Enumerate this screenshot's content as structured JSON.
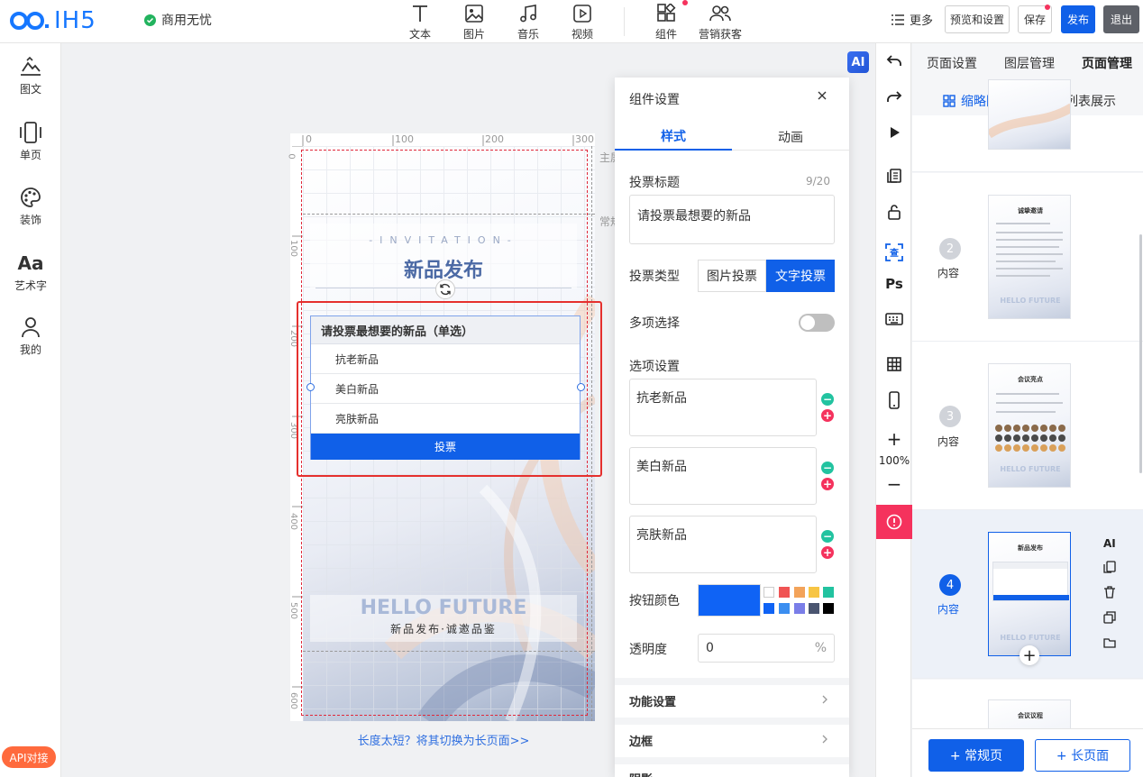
{
  "header": {
    "logo_text": "IH5",
    "status_badge": "商用无忧",
    "tools": [
      {
        "label": "文本",
        "icon": "text-icon"
      },
      {
        "label": "图片",
        "icon": "image-icon"
      },
      {
        "label": "音乐",
        "icon": "music-icon"
      },
      {
        "label": "视频",
        "icon": "video-icon"
      },
      {
        "label": "组件",
        "icon": "components-icon"
      },
      {
        "label": "营销获客",
        "icon": "users-icon"
      }
    ],
    "more_label": "更多",
    "preview_label": "预览和设置",
    "save_label": "保存",
    "publish_label": "发布",
    "exit_label": "退出"
  },
  "left_sidebar": {
    "items": [
      {
        "label": "图文",
        "icon": "image-text-icon"
      },
      {
        "label": "单页",
        "icon": "single-page-icon"
      },
      {
        "label": "装饰",
        "icon": "palette-icon"
      },
      {
        "label": "艺术字",
        "icon": "art-text-icon"
      },
      {
        "label": "我的",
        "icon": "user-icon"
      }
    ],
    "api_button": "API对接"
  },
  "canvas": {
    "ruler_top": [
      "0",
      "100",
      "200",
      "300"
    ],
    "ruler_left": [
      "0",
      "100",
      "200",
      "300",
      "400",
      "500",
      "600"
    ],
    "side_labels": [
      "主屏",
      "常规"
    ],
    "invitation_sub": "-INVITATION-",
    "invitation_title": "新品发布",
    "vote_component": {
      "question": "请投票最想要的新品（单选）",
      "options": [
        "抗老新品",
        "美白新品",
        "亮肤新品"
      ],
      "button": "投票"
    },
    "hello_title": "HELLO FUTURE",
    "hello_sub": "新品发布·诚邀品鉴",
    "long_page_link": "长度太短？将其切换为长页面>>",
    "ai_badge": "AI"
  },
  "settings_panel": {
    "title": "组件设置",
    "tabs": [
      "样式",
      "动画"
    ],
    "active_tab": "样式",
    "vote_title_label": "投票标题",
    "vote_title_count": "9/20",
    "vote_title_value": "请投票最想要的新品",
    "vote_type_label": "投票类型",
    "vote_type_options": [
      "图片投票",
      "文字投票"
    ],
    "vote_type_selected": "文字投票",
    "multi_select_label": "多项选择",
    "multi_select_on": false,
    "options_label": "选项设置",
    "options": [
      "抗老新品",
      "美白新品",
      "亮肤新品"
    ],
    "button_color_label": "按钮颜色",
    "button_color": "#0f63f5",
    "color_swatches": [
      "#ffffff",
      "#f05454",
      "#f3a35a",
      "#f7c544",
      "#22c3a0",
      "#0f63f5",
      "#3b8ef0",
      "#7a7ee8",
      "#4a5570",
      "#000000"
    ],
    "opacity_label": "透明度",
    "opacity_value": "0",
    "opacity_unit": "%",
    "groups": [
      "功能设置",
      "边框",
      "阴影"
    ]
  },
  "vertical_tools": {
    "zoom": "100%",
    "icons": [
      "undo-icon",
      "redo-icon",
      "play-icon",
      "copy-pages-icon",
      "unlock-icon",
      "check-icon",
      "ps-icon",
      "keyboard-icon",
      "grid-icon",
      "mobile-icon",
      "zoom-in-icon",
      "zoom-out-icon",
      "warning-icon"
    ]
  },
  "page_panel": {
    "tabs": [
      "页面设置",
      "图层管理",
      "页面管理"
    ],
    "active_tab": "页面管理",
    "view_thumb": "缩略图展示",
    "view_list": "列表展示",
    "pages": [
      {
        "num": "2",
        "label": "内容",
        "thumb_title": "诚挚邀请",
        "thumb_hello": "HELLO FUTURE"
      },
      {
        "num": "3",
        "label": "内容",
        "thumb_title": "会议亮点",
        "thumb_hello": "HELLO FUTURE"
      },
      {
        "num": "4",
        "label": "内容",
        "thumb_title": "新品发布",
        "thumb_hello": "HELLO FUTURE"
      },
      {
        "thumb_title": "会议议程"
      }
    ],
    "page_actions": [
      "AI",
      "copy-icon",
      "trash-icon",
      "duplicate-icon",
      "folder-icon"
    ],
    "add_normal": "+ 常规页",
    "add_long": "+ 长页面"
  }
}
